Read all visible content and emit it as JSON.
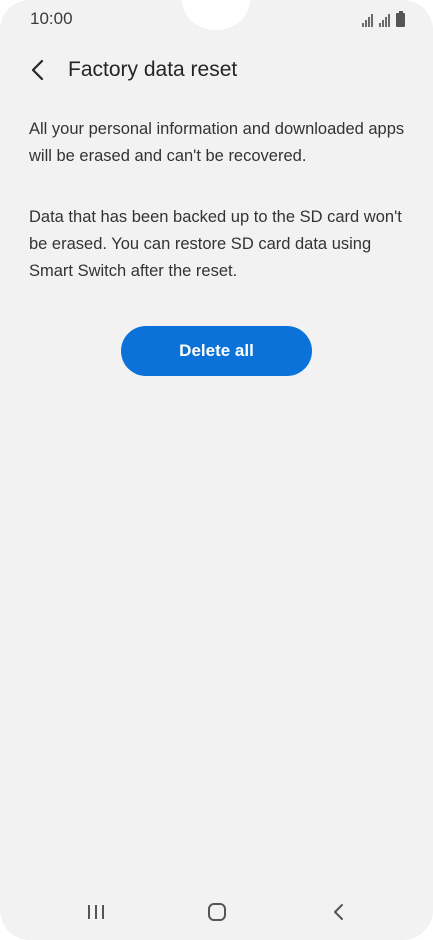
{
  "status_bar": {
    "time": "10:00",
    "icons": [
      "signal-icon",
      "signal-icon",
      "battery-icon"
    ]
  },
  "header": {
    "back_icon": "chevron-left-icon",
    "title": "Factory data reset"
  },
  "content": {
    "paragraph_1": "All your personal information and downloaded apps will be erased and can't be recovered.",
    "paragraph_2": "Data that has been backed up to the SD card won't be erased. You can restore SD card data using Smart Switch after the reset.",
    "delete_button_label": "Delete all"
  },
  "nav_bar": {
    "icons": [
      "recents-icon",
      "home-icon",
      "back-icon"
    ]
  },
  "colors": {
    "background": "#f2f2f2",
    "accent": "#0a72d8",
    "text": "#252525"
  }
}
